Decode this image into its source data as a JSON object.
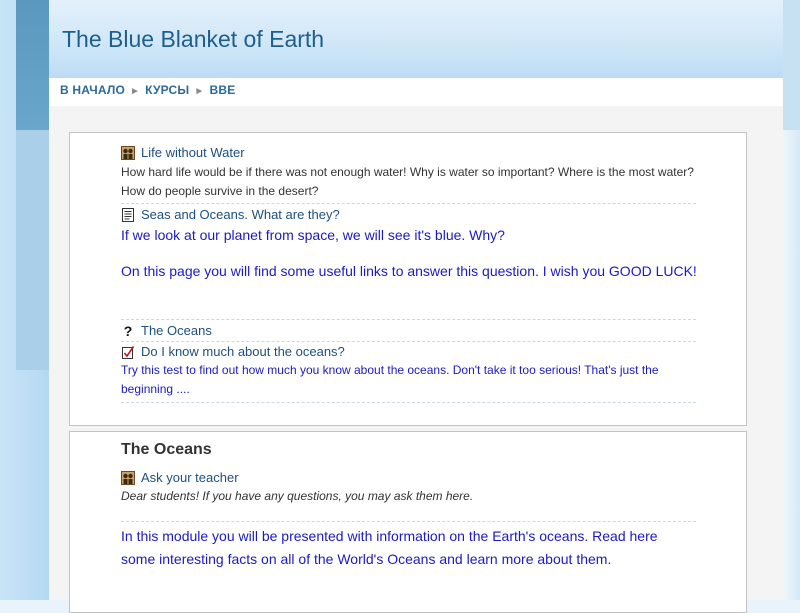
{
  "site": {
    "title": "The Blue Blanket of Earth"
  },
  "breadcrumb": {
    "items": [
      "В НАЧАЛО",
      "КУРСЫ",
      "BBE"
    ],
    "separator": "►"
  },
  "section0": {
    "forum1": {
      "icon": "forum-icon",
      "title": "Life without Water",
      "summary": "How hard life would be if there was not enough water! Why is water so important? Where is the most water? How do people survive in the desert?"
    },
    "resource1": {
      "icon": "page-icon",
      "title": "Seas and Oceans. What are they?"
    },
    "label1": "If we look at our planet from space, we will see it's blue. Why?",
    "label2": "On this page you will find some useful links to answer this question. I wish you GOOD LUCK!",
    "quiz1": {
      "icon": "question-icon",
      "title": "The Oceans"
    },
    "choice1": {
      "icon": "checkbox-icon",
      "title": "Do I know much about the oceans?"
    },
    "label3": "Try this test to find out how much you know about the oceans. Don't take it too serious! That's just the beginning ...."
  },
  "section1": {
    "title": "The Oceans",
    "forum2": {
      "icon": "forum-icon",
      "title": "Ask your teacher",
      "summary": "Dear students! If you have any questions, you may ask them here."
    },
    "label4": "In this module you will be presented with information on the Earth's oceans. Read here some interesting facts on all of the World's Oceans and learn more about them."
  }
}
